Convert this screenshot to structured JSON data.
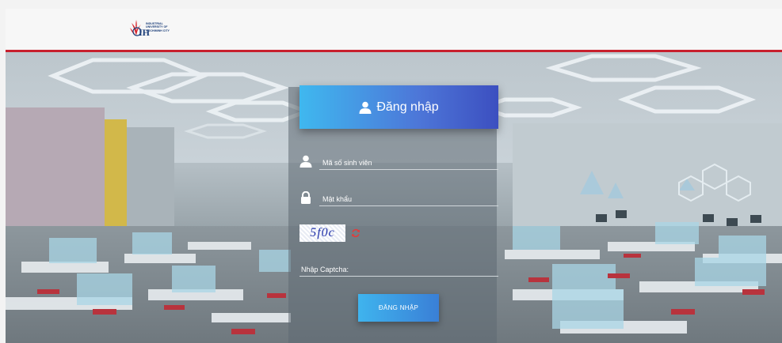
{
  "brand": {
    "logo_letters": "IH",
    "logo_text": "INDUSTRIAL\nUNIVERSITY OF\nHOCHIMINH CITY",
    "accent_color": "#c8202d"
  },
  "login": {
    "title": "Đăng nhập",
    "title_icon": "user-icon",
    "username": {
      "placeholder": "Mã số sinh viên",
      "value": "",
      "icon": "user-icon"
    },
    "password": {
      "placeholder": "Mật khẩu",
      "value": "",
      "icon": "lock-icon"
    },
    "captcha": {
      "code": "5f0c",
      "refresh_icon": "refresh-icon",
      "input_placeholder": "Nhập Captcha:",
      "value": ""
    },
    "submit_label": "ĐĂNG NHẬP",
    "header_gradient": [
      "#3fb8ef",
      "#3c4fc0"
    ]
  }
}
